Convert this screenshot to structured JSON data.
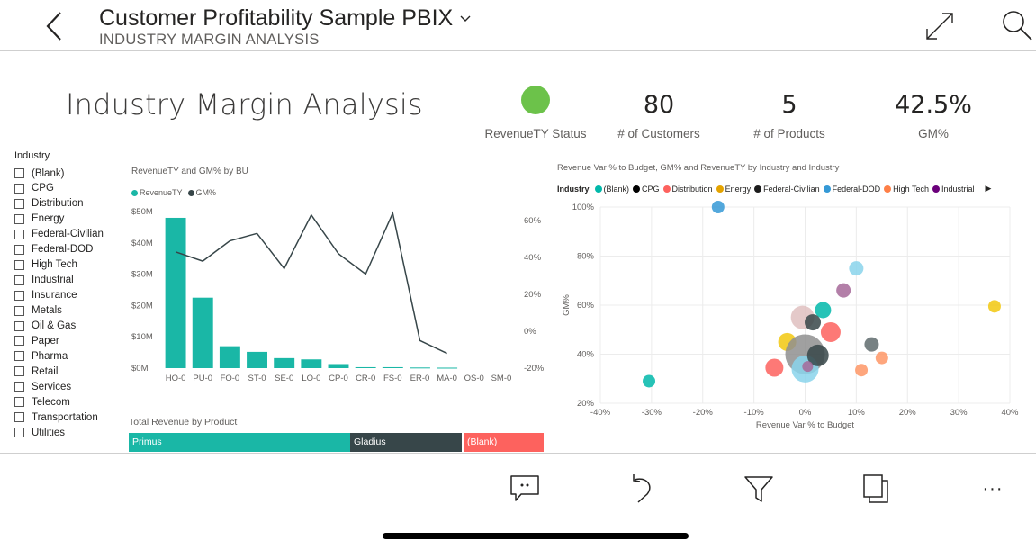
{
  "header": {
    "title": "Customer Profitability Sample PBIX",
    "subtitle": "INDUSTRY MARGIN ANALYSIS"
  },
  "report": {
    "title": "Industry Margin Analysis"
  },
  "kpis": {
    "status_label": "RevenueTY Status",
    "status_color": "#6cc24a",
    "customers_value": "80",
    "customers_label": "# of Customers",
    "products_value": "5",
    "products_label": "# of Products",
    "gm_value": "42.5%",
    "gm_label": "GM%"
  },
  "slicer": {
    "header": "Industry",
    "items": [
      "(Blank)",
      "CPG",
      "Distribution",
      "Energy",
      "Federal-Civilian",
      "Federal-DOD",
      "High Tech",
      "Industrial",
      "Insurance",
      "Metals",
      "Oil & Gas",
      "Paper",
      "Pharma",
      "Retail",
      "Services",
      "Telecom",
      "Transportation",
      "Utilities"
    ]
  },
  "bu_chart": {
    "title": "RevenueTY and GM% by BU",
    "legend": [
      {
        "label": "RevenueTY",
        "color": "#1ab7a6"
      },
      {
        "label": "GM%",
        "color": "#374649"
      }
    ]
  },
  "product_bar": {
    "title": "Total Revenue by Product",
    "segments": [
      {
        "label": "Primus",
        "color": "#1ab7a6"
      },
      {
        "label": "Gladius",
        "color": "#374649"
      },
      {
        "label": "(Blank)",
        "color": "#fd625e"
      }
    ]
  },
  "scatter": {
    "title": "Revenue Var % to Budget, GM% and RevenueTY by Industry and Industry",
    "legend_title": "Industry",
    "legend": [
      {
        "label": "(Blank)",
        "color": "#01b8aa"
      },
      {
        "label": "CPG",
        "color": "#000000"
      },
      {
        "label": "Distribution",
        "color": "#fd625e"
      },
      {
        "label": "Energy",
        "color": "#e4a300"
      },
      {
        "label": "Federal-Civilian",
        "color": "#1c1c1c"
      },
      {
        "label": "Federal-DOD",
        "color": "#3599d6"
      },
      {
        "label": "High Tech",
        "color": "#fe7f47"
      },
      {
        "label": "Industrial",
        "color": "#6b007b"
      }
    ],
    "more_arrow": "▶"
  },
  "chart_data": [
    {
      "type": "bar",
      "title": "RevenueTY and GM% by BU",
      "categories": [
        "HO-0",
        "PU-0",
        "FO-0",
        "ST-0",
        "SE-0",
        "LO-0",
        "CP-0",
        "CR-0",
        "FS-0",
        "ER-0",
        "MA-0",
        "OS-0",
        "SM-0"
      ],
      "series": [
        {
          "name": "RevenueTY",
          "type": "bar",
          "axis": "left",
          "values": [
            48000000,
            22500000,
            7000000,
            5200000,
            3200000,
            2800000,
            1300000,
            300000,
            300000,
            200000,
            150000,
            0,
            0
          ]
        },
        {
          "name": "GM%",
          "type": "line",
          "axis": "right",
          "values": [
            43,
            38,
            49,
            53,
            34,
            63,
            42,
            31,
            64,
            -5,
            -12,
            null,
            null
          ]
        }
      ],
      "y_left": {
        "ticks": [
          "$0M",
          "$10M",
          "$20M",
          "$30M",
          "$40M",
          "$50M"
        ],
        "lim": [
          0,
          50000000
        ]
      },
      "y_right": {
        "ticks": [
          "-20%",
          "0%",
          "20%",
          "40%",
          "60%"
        ],
        "lim": [
          -20,
          60
        ]
      }
    },
    {
      "type": "scatter",
      "title": "Revenue Var % to Budget, GM% and RevenueTY by Industry and Industry",
      "xlabel": "Revenue Var % to Budget",
      "ylabel": "GM%",
      "xlim": [
        -40,
        40
      ],
      "ylim": [
        20,
        100
      ],
      "x_ticks": [
        "-40%",
        "-30%",
        "-20%",
        "-10%",
        "0%",
        "10%",
        "20%",
        "30%",
        "40%"
      ],
      "y_ticks": [
        "20%",
        "40%",
        "60%",
        "80%",
        "100%"
      ],
      "points": [
        {
          "x": -17,
          "y": 100,
          "size": 7,
          "color": "#3599d6"
        },
        {
          "x": -30.5,
          "y": 29,
          "size": 7,
          "color": "#01b8aa"
        },
        {
          "x": 10,
          "y": 75,
          "size": 8,
          "color": "#8ad4eb"
        },
        {
          "x": 37,
          "y": 59.5,
          "size": 7,
          "color": "#f2c80f"
        },
        {
          "x": 7.5,
          "y": 66,
          "size": 8,
          "color": "#a66999"
        },
        {
          "x": -0.5,
          "y": 55,
          "size": 13,
          "color": "#dfbfbf"
        },
        {
          "x": 3.5,
          "y": 58,
          "size": 9,
          "color": "#01b8aa"
        },
        {
          "x": 1.5,
          "y": 53,
          "size": 9,
          "color": "#374649"
        },
        {
          "x": 5,
          "y": 49,
          "size": 11,
          "color": "#fd625e"
        },
        {
          "x": -3.5,
          "y": 45,
          "size": 10,
          "color": "#f2c80f"
        },
        {
          "x": 0,
          "y": 40,
          "size": 22,
          "color": "#8f8f8f"
        },
        {
          "x": 0,
          "y": 34,
          "size": 15,
          "color": "#8ad4eb"
        },
        {
          "x": 2.5,
          "y": 39.5,
          "size": 12,
          "color": "#374649"
        },
        {
          "x": -6,
          "y": 34.5,
          "size": 10,
          "color": "#fd625e"
        },
        {
          "x": 0.5,
          "y": 35,
          "size": 6,
          "color": "#a66999"
        },
        {
          "x": 13,
          "y": 44,
          "size": 8,
          "color": "#5f6b6d"
        },
        {
          "x": 15,
          "y": 38.5,
          "size": 7,
          "color": "#fe9666"
        },
        {
          "x": 11,
          "y": 33.5,
          "size": 7,
          "color": "#fe9666"
        }
      ]
    }
  ],
  "toolbar": {
    "comment_icon": "comment-icon",
    "undo_icon": "undo-icon",
    "filter_icon": "filter-icon",
    "pages_icon": "pages-icon",
    "more_label": "···"
  }
}
